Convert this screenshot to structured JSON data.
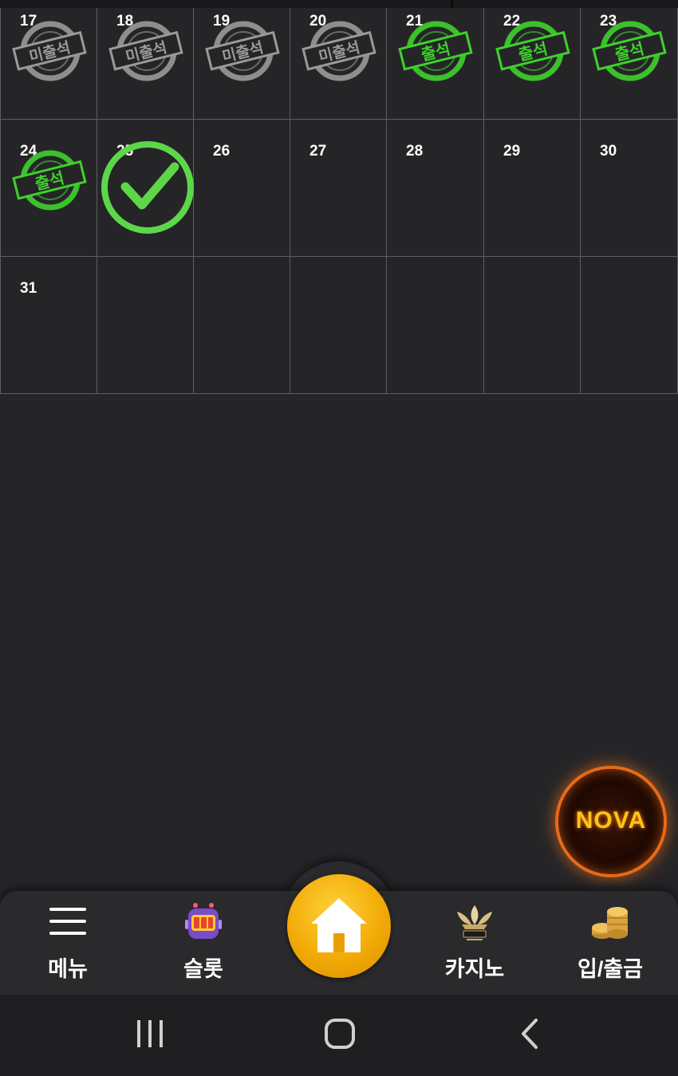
{
  "calendar": {
    "rows": [
      [
        {
          "day": "17",
          "stamp": "absent"
        },
        {
          "day": "18",
          "stamp": "absent"
        },
        {
          "day": "19",
          "stamp": "absent"
        },
        {
          "day": "20",
          "stamp": "absent"
        },
        {
          "day": "21",
          "stamp": "present"
        },
        {
          "day": "22",
          "stamp": "present"
        },
        {
          "day": "23",
          "stamp": "present"
        }
      ],
      [
        {
          "day": "24",
          "stamp": "present"
        },
        {
          "day": "25",
          "stamp": "today-check"
        },
        {
          "day": "26",
          "stamp": ""
        },
        {
          "day": "27",
          "stamp": ""
        },
        {
          "day": "28",
          "stamp": ""
        },
        {
          "day": "29",
          "stamp": ""
        },
        {
          "day": "30",
          "stamp": ""
        }
      ],
      [
        {
          "day": "31",
          "stamp": ""
        },
        {
          "day": "",
          "stamp": ""
        },
        {
          "day": "",
          "stamp": ""
        },
        {
          "day": "",
          "stamp": ""
        },
        {
          "day": "",
          "stamp": ""
        },
        {
          "day": "",
          "stamp": ""
        },
        {
          "day": "",
          "stamp": ""
        }
      ]
    ],
    "stamp_absent_text": "미출석",
    "stamp_present_text": "출석",
    "colors": {
      "present": "#3fd12c",
      "absent": "#9a9a9a",
      "check": "#5ed64a"
    }
  },
  "floating": {
    "logo_text": "NOVA",
    "icon": "nova-logo"
  },
  "bottom_nav": {
    "items": [
      {
        "label": "메뉴",
        "icon": "hamburger-menu-icon"
      },
      {
        "label": "슬롯",
        "icon": "slot-machine-icon"
      },
      {
        "label": "카지노",
        "icon": "k-slot-casino-icon"
      },
      {
        "label": "입/출금",
        "icon": "coin-stack-icon"
      }
    ],
    "home_icon": "home-icon"
  },
  "system_nav": {
    "recent": "recent-apps-icon",
    "home": "system-home-icon",
    "back": "back-icon"
  }
}
